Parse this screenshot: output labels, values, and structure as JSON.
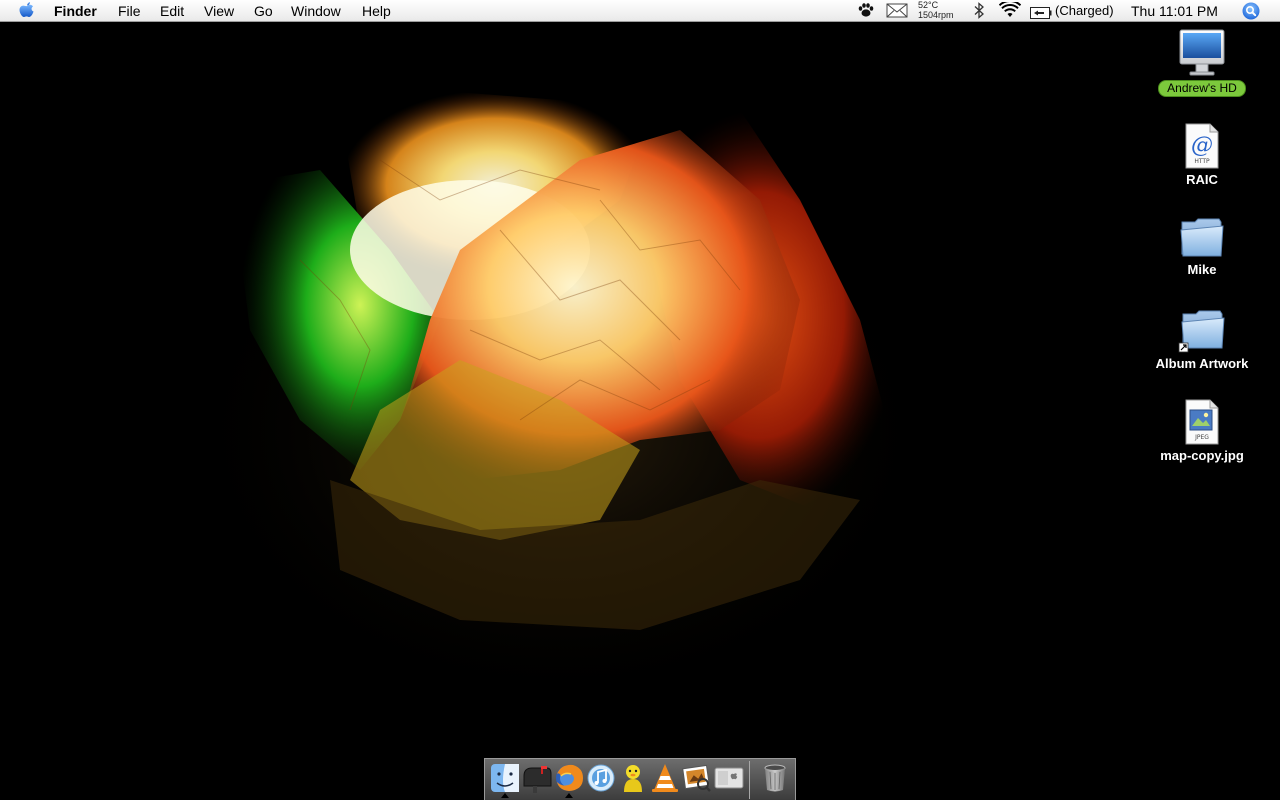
{
  "menubar": {
    "apple_icon": "apple-icon",
    "app_name": "Finder",
    "menus": [
      "File",
      "Edit",
      "View",
      "Go",
      "Window",
      "Help"
    ],
    "status": {
      "temperature": "52°C",
      "fan_speed": "1504rpm",
      "battery_status": "(Charged)",
      "clock": "Thu 11:01 PM"
    },
    "icons": [
      "paw-icon",
      "mail-icon",
      "bluetooth-icon",
      "wifi-icon",
      "battery-icon",
      "spotlight-icon"
    ]
  },
  "desktop": {
    "icons": [
      {
        "label": "Andrew's HD",
        "icon": "hard-drive-icon",
        "selected": true
      },
      {
        "label": "RAIC",
        "icon": "http-location-icon",
        "selected": false
      },
      {
        "label": "Mike",
        "icon": "folder-icon",
        "selected": false
      },
      {
        "label": "Album Artwork",
        "icon": "folder-alias-icon",
        "selected": false
      },
      {
        "label": "map-copy.jpg",
        "icon": "jpeg-file-icon",
        "selected": false
      }
    ]
  },
  "dock": {
    "items": [
      {
        "name": "Finder",
        "icon": "finder-icon",
        "running": true
      },
      {
        "name": "Mail",
        "icon": "mail-icon",
        "running": false
      },
      {
        "name": "Firefox",
        "icon": "firefox-icon",
        "running": true
      },
      {
        "name": "iTunes",
        "icon": "itunes-icon",
        "running": false
      },
      {
        "name": "Adium",
        "icon": "adium-icon",
        "running": false
      },
      {
        "name": "VLC",
        "icon": "vlc-icon",
        "running": false
      },
      {
        "name": "Preview",
        "icon": "preview-icon",
        "running": false
      },
      {
        "name": "Boot Camp",
        "icon": "bootcamp-icon",
        "running": false
      },
      {
        "name": "Trash",
        "icon": "trash-icon",
        "running": false
      }
    ]
  }
}
